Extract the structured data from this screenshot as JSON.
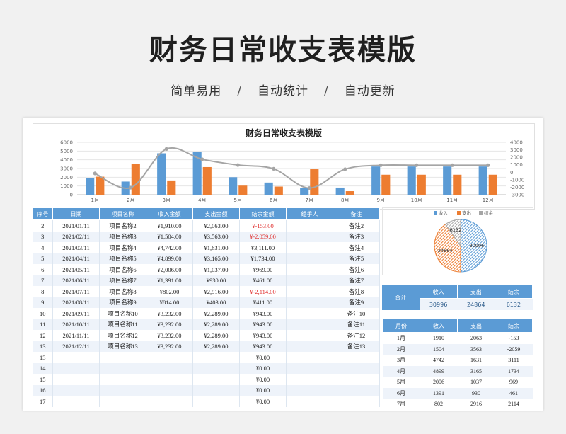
{
  "page": {
    "title": "财务日常收支表模版",
    "subtitle_items": [
      "简单易用",
      "自动统计",
      "自动更新"
    ],
    "subtitle_sep": "/"
  },
  "chart_data": {
    "type": "bar+line",
    "title": "财务日常收支表模版",
    "categories": [
      "1月",
      "2月",
      "3月",
      "4月",
      "5月",
      "6月",
      "7月",
      "8月",
      "9月",
      "10月",
      "11月",
      "12月"
    ],
    "series": [
      {
        "name": "收入",
        "type": "bar",
        "axis": "left",
        "color": "#5b9bd5",
        "values": [
          1910,
          1504,
          4742,
          4899,
          2006,
          1391,
          802,
          814,
          3232,
          3232,
          3232,
          3232
        ]
      },
      {
        "name": "支出",
        "type": "bar",
        "axis": "left",
        "color": "#ed7d31",
        "values": [
          2063,
          3563,
          1631,
          3165,
          1037,
          930,
          2916,
          403,
          2289,
          2289,
          2289,
          2289
        ]
      },
      {
        "name": "结余",
        "type": "line",
        "axis": "right",
        "color": "#a5a5a5",
        "values": [
          -153,
          -2059,
          3111,
          1734,
          969,
          461,
          -2114,
          411,
          943,
          943,
          943,
          943
        ]
      }
    ],
    "y_left": {
      "ticks": [
        "0",
        "1000",
        "2000",
        "3000",
        "4000",
        "5000",
        "6000"
      ],
      "ylim": [
        0,
        6000
      ]
    },
    "y_right": {
      "ticks": [
        "-3000",
        "-2000",
        "-1000",
        "0",
        "1000",
        "2000",
        "3000",
        "4000"
      ],
      "ylim": [
        -3000,
        4000
      ]
    }
  },
  "table": {
    "headers": [
      "序号",
      "日期",
      "项目名称",
      "收入金额",
      "支出金额",
      "结余金额",
      "经手人",
      "备注"
    ],
    "rows": [
      [
        "2",
        "2021/01/11",
        "项目名称2",
        "¥1,910.00",
        "¥2,063.00",
        "¥-153.00",
        "",
        "备注2"
      ],
      [
        "3",
        "2021/02/11",
        "项目名称3",
        "¥1,504.00",
        "¥3,563.00",
        "¥-2,059.00",
        "",
        "备注3"
      ],
      [
        "4",
        "2021/03/11",
        "项目名称4",
        "¥4,742.00",
        "¥1,631.00",
        "¥3,111.00",
        "",
        "备注4"
      ],
      [
        "5",
        "2021/04/11",
        "项目名称5",
        "¥4,899.00",
        "¥3,165.00",
        "¥1,734.00",
        "",
        "备注5"
      ],
      [
        "6",
        "2021/05/11",
        "项目名称6",
        "¥2,006.00",
        "¥1,037.00",
        "¥969.00",
        "",
        "备注6"
      ],
      [
        "7",
        "2021/06/11",
        "项目名称7",
        "¥1,391.00",
        "¥930.00",
        "¥461.00",
        "",
        "备注7"
      ],
      [
        "8",
        "2021/07/11",
        "项目名称8",
        "¥802.00",
        "¥2,916.00",
        "¥-2,114.00",
        "",
        "备注8"
      ],
      [
        "9",
        "2021/08/11",
        "项目名称9",
        "¥814.00",
        "¥403.00",
        "¥411.00",
        "",
        "备注9"
      ],
      [
        "10",
        "2021/09/11",
        "项目名称10",
        "¥3,232.00",
        "¥2,289.00",
        "¥943.00",
        "",
        "备注10"
      ],
      [
        "11",
        "2021/10/11",
        "项目名称11",
        "¥3,232.00",
        "¥2,289.00",
        "¥943.00",
        "",
        "备注11"
      ],
      [
        "12",
        "2021/11/11",
        "项目名称12",
        "¥3,232.00",
        "¥2,289.00",
        "¥943.00",
        "",
        "备注12"
      ],
      [
        "13",
        "2021/12/11",
        "项目名称13",
        "¥3,232.00",
        "¥2,289.00",
        "¥943.00",
        "",
        "备注13"
      ],
      [
        "13",
        "",
        "",
        "",
        "",
        "¥0.00",
        "",
        ""
      ],
      [
        "14",
        "",
        "",
        "",
        "",
        "¥0.00",
        "",
        ""
      ],
      [
        "15",
        "",
        "",
        "",
        "",
        "¥0.00",
        "",
        ""
      ],
      [
        "16",
        "",
        "",
        "",
        "",
        "¥0.00",
        "",
        ""
      ],
      [
        "17",
        "",
        "",
        "",
        "",
        "¥0.00",
        "",
        ""
      ]
    ]
  },
  "pie": {
    "legend": [
      "收入",
      "支出",
      "结余"
    ],
    "values": [
      30996,
      24864,
      6132
    ],
    "labels": [
      "30996",
      "24864",
      "6132"
    ]
  },
  "summary": {
    "label": "合计",
    "headers": [
      "收入",
      "支出",
      "结余"
    ],
    "values": [
      "30996",
      "24864",
      "6132"
    ]
  },
  "monthly": {
    "headers": [
      "月份",
      "收入",
      "支出",
      "结余"
    ],
    "rows": [
      [
        "1月",
        "1910",
        "2063",
        "-153"
      ],
      [
        "2月",
        "1504",
        "3563",
        "-2059"
      ],
      [
        "3月",
        "4742",
        "1631",
        "3111"
      ],
      [
        "4月",
        "4899",
        "3165",
        "1734"
      ],
      [
        "5月",
        "2006",
        "1037",
        "969"
      ],
      [
        "6月",
        "1391",
        "930",
        "461"
      ],
      [
        "7月",
        "802",
        "2916",
        "2114"
      ]
    ]
  }
}
